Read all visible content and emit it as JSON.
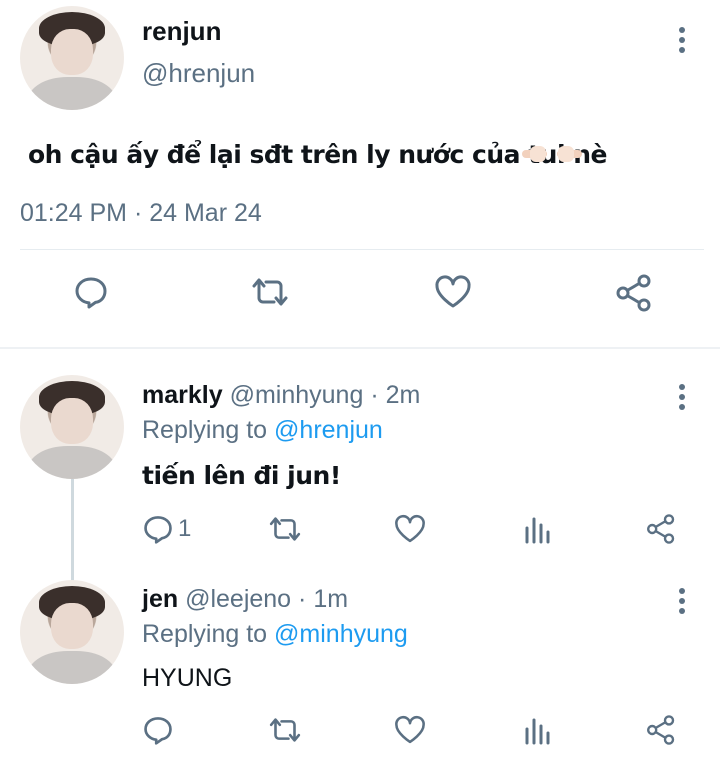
{
  "main_tweet": {
    "name": "renjun",
    "handle": "@hrenjun",
    "text": "oh cậu ấy để lại sđt trên ly nước của tui nè",
    "timestamp": "01:24 PM · 24 Mar 24"
  },
  "replies": [
    {
      "name": "markly",
      "handle": "@minhyung",
      "time": "· 2m",
      "replying_prefix": "Replying to",
      "replying_to": "@hrenjun",
      "text": "tiến lên đi jun!",
      "reply_count": "1"
    },
    {
      "name": "jen",
      "handle": "@leejeno",
      "time": "· 1m",
      "replying_prefix": "Replying to",
      "replying_to": "@minhyung",
      "text": "HYUNG",
      "reply_count": ""
    }
  ],
  "colors": {
    "primary_text": "#0f1419",
    "secondary_text": "#5b7083",
    "link": "#1d9bf0",
    "divider": "#e6ecf0"
  },
  "icons": {
    "main_actions": [
      "reply-icon",
      "retweet-icon",
      "like-icon",
      "share-icon"
    ],
    "reply_actions": [
      "reply-icon",
      "retweet-icon",
      "like-icon",
      "analytics-icon",
      "share-icon"
    ],
    "menu": "more-vertical-icon"
  }
}
